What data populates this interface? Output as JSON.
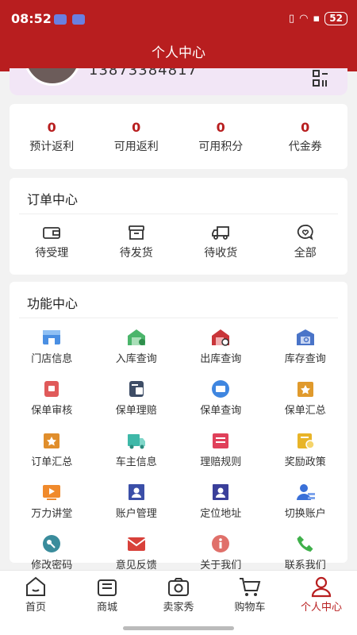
{
  "status": {
    "time": "08:52",
    "battery": "52"
  },
  "header": {
    "title": "个人中心"
  },
  "profile": {
    "phone": "13873384817"
  },
  "stats": [
    {
      "value": "0",
      "label": "预计返利"
    },
    {
      "value": "0",
      "label": "可用返利"
    },
    {
      "value": "0",
      "label": "可用积分"
    },
    {
      "value": "0",
      "label": "代金券"
    }
  ],
  "orders": {
    "title": "订单中心",
    "items": [
      {
        "label": "待受理",
        "icon": "wallet-icon"
      },
      {
        "label": "待发货",
        "icon": "box-icon"
      },
      {
        "label": "待收货",
        "icon": "truck-icon"
      },
      {
        "label": "全部",
        "icon": "heart-bubble-icon"
      }
    ]
  },
  "functions": {
    "title": "功能中心",
    "items": [
      {
        "label": "门店信息",
        "icon": "store-icon",
        "color": "#4a8fe3"
      },
      {
        "label": "入库查询",
        "icon": "warehouse-in-icon",
        "color": "#4bb56b"
      },
      {
        "label": "出库查询",
        "icon": "warehouse-out-icon",
        "color": "#c9363a"
      },
      {
        "label": "库存查询",
        "icon": "inventory-icon",
        "color": "#4a74c8"
      },
      {
        "label": "保单审核",
        "icon": "policy-review-icon",
        "color": "#e05a5a"
      },
      {
        "label": "保单理赔",
        "icon": "policy-claim-icon",
        "color": "#3e4d66"
      },
      {
        "label": "保单查询",
        "icon": "policy-search-icon",
        "color": "#3f86e0"
      },
      {
        "label": "保单汇总",
        "icon": "policy-summary-icon",
        "color": "#e09a2c"
      },
      {
        "label": "订单汇总",
        "icon": "order-summary-icon",
        "color": "#e08e2c"
      },
      {
        "label": "车主信息",
        "icon": "car-owner-icon",
        "color": "#3eb8a8"
      },
      {
        "label": "理赔规则",
        "icon": "claim-rules-icon",
        "color": "#e0405a"
      },
      {
        "label": "奖励政策",
        "icon": "reward-policy-icon",
        "color": "#e8b428"
      },
      {
        "label": "万力讲堂",
        "icon": "video-lecture-icon",
        "color": "#f08a2c"
      },
      {
        "label": "账户管理",
        "icon": "account-manage-icon",
        "color": "#3b4fa8"
      },
      {
        "label": "定位地址",
        "icon": "location-icon",
        "color": "#3a3f9a"
      },
      {
        "label": "切换账户",
        "icon": "switch-account-icon",
        "color": "#3a70d8"
      },
      {
        "label": "修改密码",
        "icon": "key-icon",
        "color": "#3a8c9c"
      },
      {
        "label": "意见反馈",
        "icon": "feedback-mail-icon",
        "color": "#d8413a"
      },
      {
        "label": "关于我们",
        "icon": "info-icon",
        "color": "#e0706a"
      },
      {
        "label": "联系我们",
        "icon": "phone-icon",
        "color": "#3fb04a"
      }
    ]
  },
  "tabbar": [
    {
      "label": "首页",
      "icon": "home-icon",
      "active": false
    },
    {
      "label": "商城",
      "icon": "shop-icon",
      "active": false
    },
    {
      "label": "卖家秀",
      "icon": "camera-icon",
      "active": false
    },
    {
      "label": "购物车",
      "icon": "cart-icon",
      "active": false
    },
    {
      "label": "个人中心",
      "icon": "user-icon",
      "active": true
    }
  ],
  "colors": {
    "primary": "#b81e1f",
    "profile_bg": "#f2e6f6"
  }
}
